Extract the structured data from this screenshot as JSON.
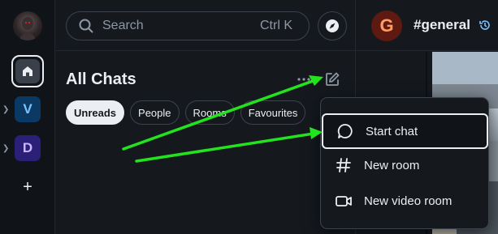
{
  "spacebar": {
    "spaces": [
      {
        "initial": "V",
        "color": "#79c4ff"
      },
      {
        "initial": "D",
        "color": "#c9b8ff"
      }
    ],
    "add_label": "+"
  },
  "header": {
    "search": {
      "placeholder": "Search",
      "shortcut": "Ctrl K"
    }
  },
  "roomlist": {
    "title": "All Chats",
    "filters": [
      "Unreads",
      "People",
      "Rooms",
      "Favourites"
    ],
    "active_filter": "Unreads"
  },
  "room": {
    "avatar_initial": "G",
    "name": "#general"
  },
  "menu": {
    "items": [
      {
        "label": "Start chat",
        "icon": "chat-bubble-icon",
        "highlighted": true
      },
      {
        "label": "New room",
        "icon": "hash-icon"
      },
      {
        "label": "New video room",
        "icon": "video-camera-icon"
      }
    ]
  },
  "colors": {
    "background": "#15191e",
    "accent_annotation": "#22e31d",
    "text": "#ebeef2"
  }
}
